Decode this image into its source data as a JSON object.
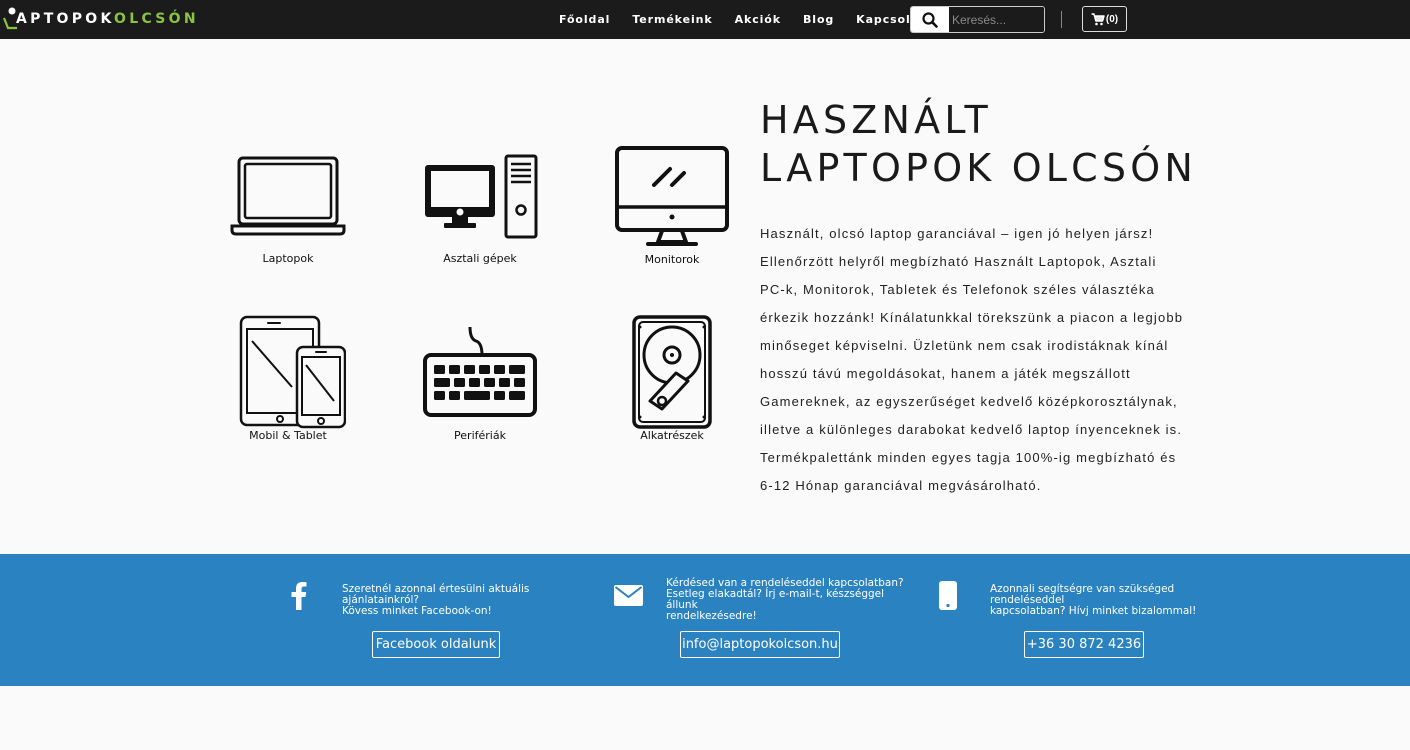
{
  "header": {
    "logo_prefix": "APTOPOK",
    "logo_suffix": "OLCSÓN",
    "nav": [
      "Főoldal",
      "Termékeink",
      "Akciók",
      "Blog",
      "Kapcsolat"
    ],
    "search_placeholder": "Keresés...",
    "cart_count": "(0)"
  },
  "categories": [
    {
      "label": "Laptopok",
      "icon": "laptop-icon"
    },
    {
      "label": "Asztali gépek",
      "icon": "desktop-pc-icon"
    },
    {
      "label": "Monitorok",
      "icon": "monitor-icon"
    },
    {
      "label": "Mobil & Tablet",
      "icon": "tablet-phone-icon"
    },
    {
      "label": "Perifériák",
      "icon": "keyboard-icon"
    },
    {
      "label": "Alkatrészek",
      "icon": "hard-drive-icon"
    }
  ],
  "hero": {
    "title_line1": "HASZNÁLT",
    "title_line2": "LAPTOPOK OLCSÓN",
    "lines": [
      "Használt, olcsó laptop garanciával – igen jó helyen jársz!",
      "Ellenőrzött helyről megbízható Használt Laptopok, Asztali",
      "PC-k, Monitorok, Tabletek és Telefonok széles választéka",
      "érkezik hozzánk! Kínálatunkkal törekszünk a piacon a legjobb",
      "minőseget képviselni. Üzletünk nem csak irodistáknak kínál",
      "hosszú távú megoldásokat, hanem a játék megszállott",
      "Gamereknek, az egyszerűséget kedvelő középkorosztálynak,",
      "illetve a különleges darabokat kedvelő laptop ínyenceknek is.",
      "Termékpalettánk minden egyes tagja 100%-ig megbízható és",
      "6-12 Hónap garanciával megvásárolható."
    ]
  },
  "contact": {
    "facebook": {
      "line1": "Szeretnél azonnal értesülni aktuális ajánlatainkról?",
      "line2": "Kövess minket Facebook-on!",
      "button": "Facebook oldalunk"
    },
    "email": {
      "line1": "Kérdésed van a rendeléseddel kapcsolatban?",
      "line2": "Esetleg elakadtál? Írj e-mail-t, készséggel állunk",
      "line3": "rendelkezésedre!",
      "button": "info@laptopokolcson.hu"
    },
    "phone": {
      "line1": "Azonnali segítségre van szükséged rendeléseddel",
      "line2": "kapcsolatban? Hívj minket bizalommal!",
      "button": "+36 30 872 4236"
    }
  },
  "colors": {
    "topbar": "#1b1b1b",
    "logo_accent": "#8ac43f",
    "band": "#2b82c1"
  }
}
